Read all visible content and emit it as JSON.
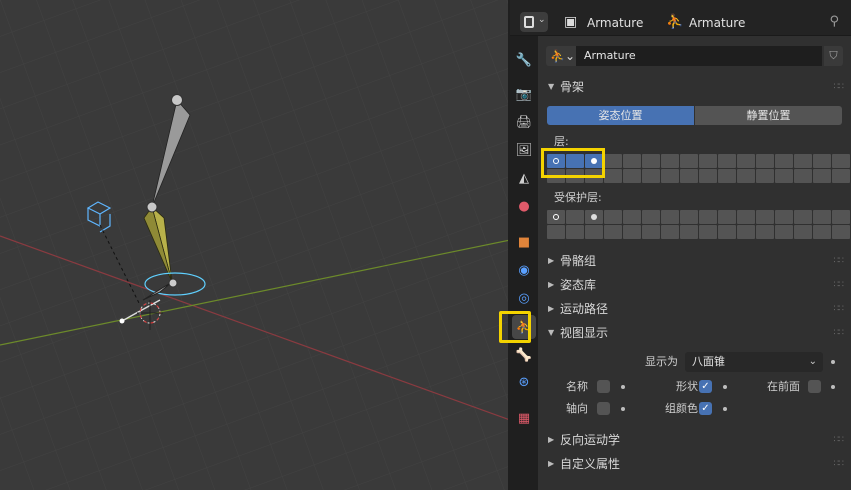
{
  "header": {
    "crumb_object": "Armature",
    "crumb_data": "Armature"
  },
  "datablock": {
    "name": "Armature",
    "type_icon": "armature-icon",
    "fake_user_icon": "shield-icon"
  },
  "panels": {
    "skeleton": {
      "title": "骨架",
      "pose_position": "姿态位置",
      "rest_position": "静置位置",
      "layers_label": "层:",
      "protected_layers_label": "受保护层:"
    },
    "bone_groups": "骨骼组",
    "pose_library": "姿态库",
    "motion_paths": "运动路径",
    "viewport_display": {
      "title": "视图显示",
      "display_as_label": "显示为",
      "display_as_value": "八面锥",
      "names_label": "名称",
      "names_checked": false,
      "shapes_label": "形状",
      "shapes_checked": true,
      "in_front_label": "在前面",
      "in_front_checked": false,
      "axes_label": "轴向",
      "axes_checked": false,
      "group_colors_label": "组颜色",
      "group_colors_checked": true
    },
    "inverse_kinematics": "反向运动学",
    "custom_properties": "自定义属性"
  },
  "colors": {
    "accent_blue": "#4772b3",
    "highlight_yellow": "#f4d300",
    "active_tab_green": "#3dbf8a"
  },
  "tabs": [
    "tool-icon",
    "render-icon",
    "output-icon",
    "view-layer-icon",
    "scene-icon",
    "world-icon",
    "object-icon",
    "modifier-icon",
    "particles-icon",
    "physics-icon",
    "armature-data-icon",
    "bone-icon",
    "bone-constraint-icon",
    "texture-icon"
  ],
  "active_tab": "armature-data-icon"
}
